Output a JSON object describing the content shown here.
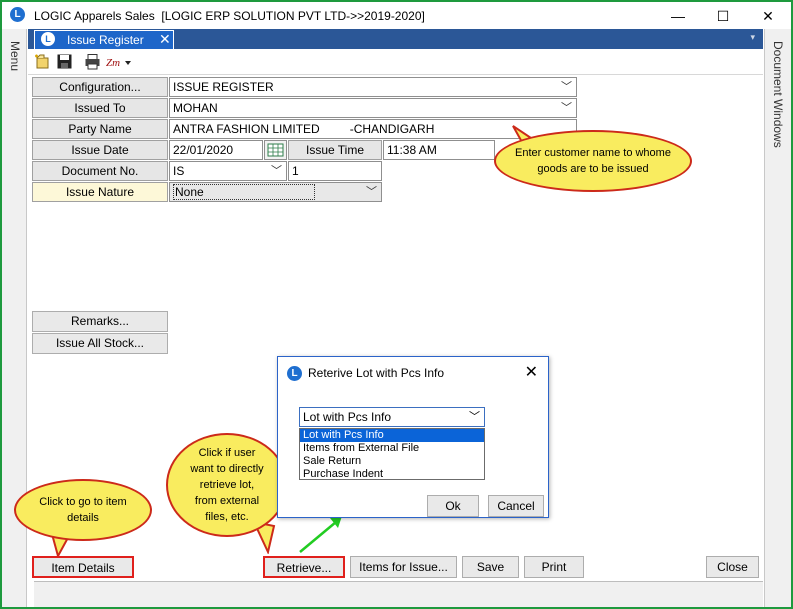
{
  "window": {
    "title": "LOGIC Apparels Sales  [LOGIC ERP SOLUTION PVT LTD->>2019-2020]",
    "logo_letter": "L",
    "minimize": "—",
    "maximize": "☐",
    "close": "✕"
  },
  "side": {
    "left_label": "Menu",
    "right_label": "Document Windows"
  },
  "tab": {
    "label": "Issue Register",
    "close": "✕",
    "overflow": "▾"
  },
  "form": {
    "configuration_label": "Configuration...",
    "configuration_value": "ISSUE REGISTER",
    "issued_to_label": "Issued To",
    "issued_to_value": "MOHAN",
    "party_name_label": "Party Name",
    "party_name_value": "ANTRA FASHION LIMITED         -CHANDIGARH",
    "issue_date_label": "Issue Date",
    "issue_date_value": "22/01/2020",
    "issue_time_label": "Issue Time",
    "issue_time_value": "11:38 AM",
    "document_no_label": "Document No.",
    "document_prefix": "IS",
    "document_number": "1",
    "issue_nature_label": "Issue Nature",
    "issue_nature_value": "None",
    "remarks_button": "Remarks...",
    "issue_all_stock_button": "Issue All Stock..."
  },
  "dialog": {
    "title": "Reterive Lot with Pcs Info",
    "close": "✕",
    "selected": "Lot with Pcs Info",
    "options": [
      "Lot with Pcs Info",
      "Items from External File",
      "Sale Return",
      "Purchase Indent"
    ],
    "ok": "Ok",
    "cancel": "Cancel"
  },
  "bottom": {
    "item_details": "Item Details",
    "retrieve": "Retrieve...",
    "items_for_issue": "Items for Issue...",
    "save": "Save",
    "print": "Print",
    "close": "Close"
  },
  "callouts": {
    "customer": "Enter customer name to whome goods are to be issued",
    "item_details": "Click to go to item details",
    "retrieve": "Click if user want to directly retrieve lot, from external files, etc."
  },
  "colors": {
    "frame": "#1e9a3e",
    "highlight": "#e0201c",
    "bubble": "#f9ec5f",
    "tab": "#1e66c9"
  }
}
